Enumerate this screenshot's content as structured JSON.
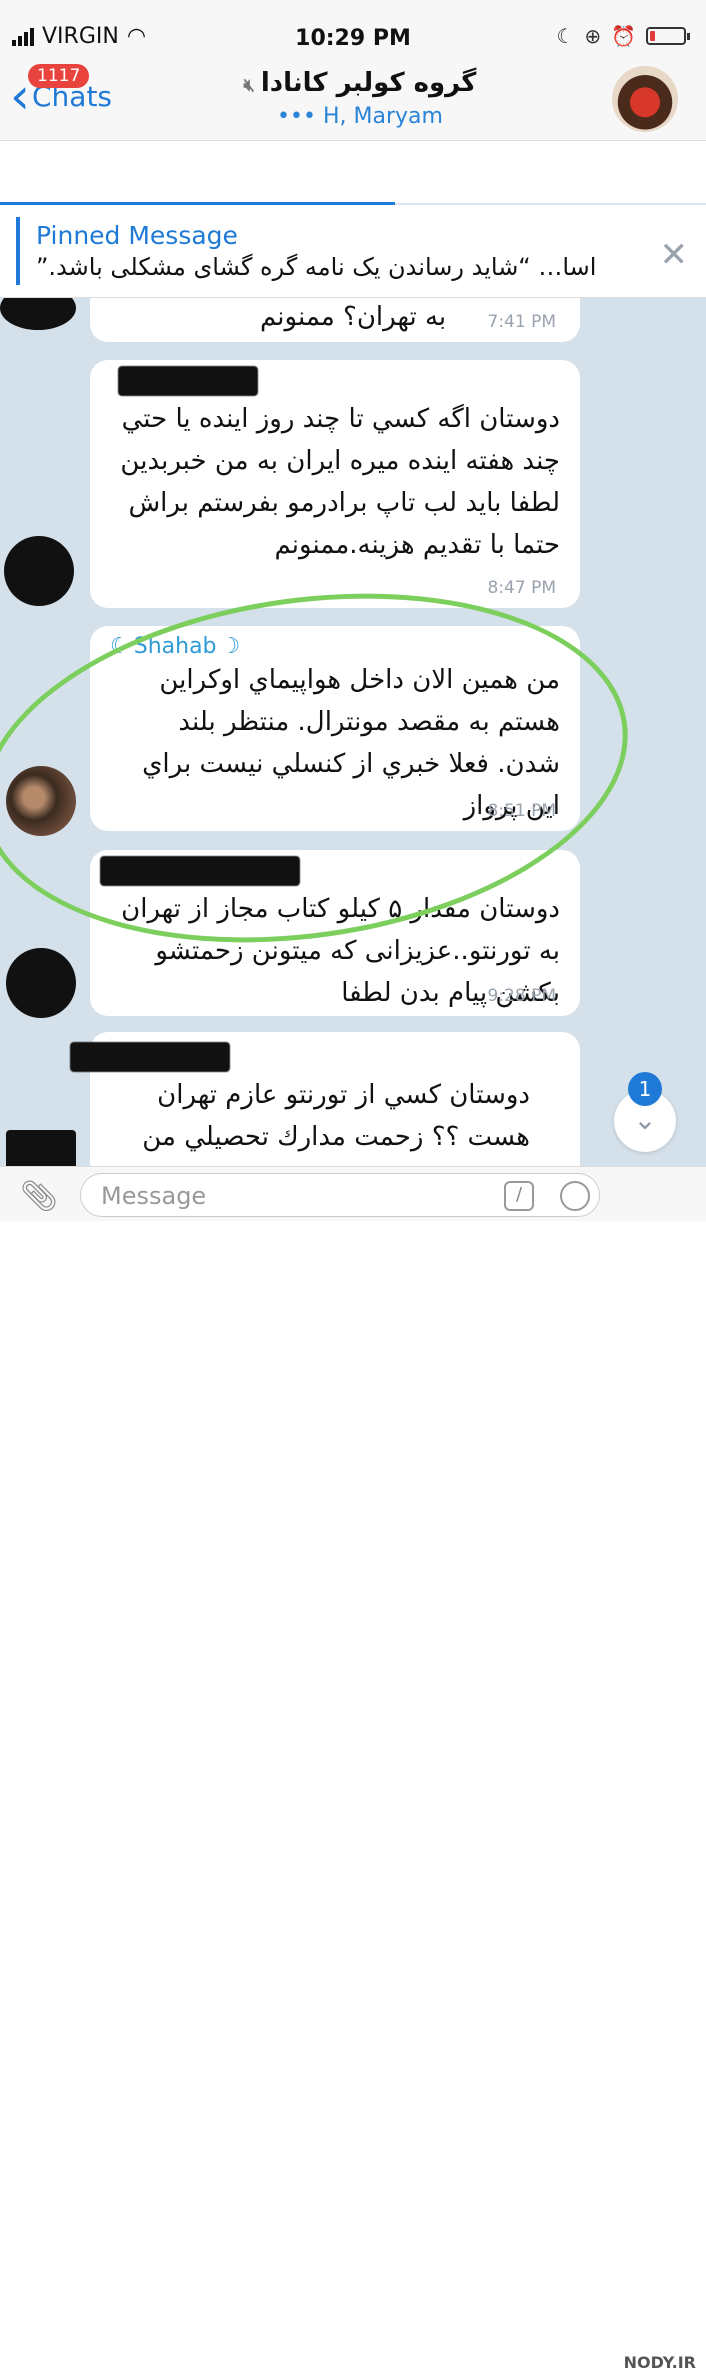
{
  "status_bar": {
    "carrier": "VIRGIN",
    "time": "10:29 PM",
    "battery_level": 0.15
  },
  "nav": {
    "back_label": "Chats",
    "unread_badge": "1117",
    "title": "گروه کولبر کانادا",
    "subtitle": "••• H, Maryam"
  },
  "pinned": {
    "title": "Pinned Message",
    "text": "اسا… “شاید رساندن یک نامه گره گشای مشکلی باشد.”"
  },
  "messages": [
    {
      "text": "به تهران؟ ممنونم",
      "time": "7:41 PM"
    },
    {
      "text": "دوستان اگه كسي تا چند روز اينده يا حتي چند هفته اينده ميره ايران به من خبربدين لطفا بايد لب تاپ برادرمو بفرستم براش حتما با تقديم هزينه.ممنونم",
      "time": "8:47 PM"
    },
    {
      "sender": "Shahab",
      "text": "من همين الان داخل هواپيماي اوكراين هستم به مقصد مونترال. منتظر بلند شدن. فعلا خبري از كنسلي نيست براي اين پرواز",
      "time": "8:51 PM"
    },
    {
      "text": "دوستان مقدار ۵ کیلو کتاب مجاز از تهران به تورنتو..عزیزانی که میتونن زحمتشو بکشن پیام بدن لطفا",
      "time": "9:28 PM"
    },
    {
      "text": "دوستان كسي از تورنتو عازم تهران هست ؟؟ زحمت مدارك تحصيلي من",
      "time": ""
    }
  ],
  "scroll_badge": "1",
  "input": {
    "placeholder": "Message"
  },
  "watermark": "NODY.IR"
}
